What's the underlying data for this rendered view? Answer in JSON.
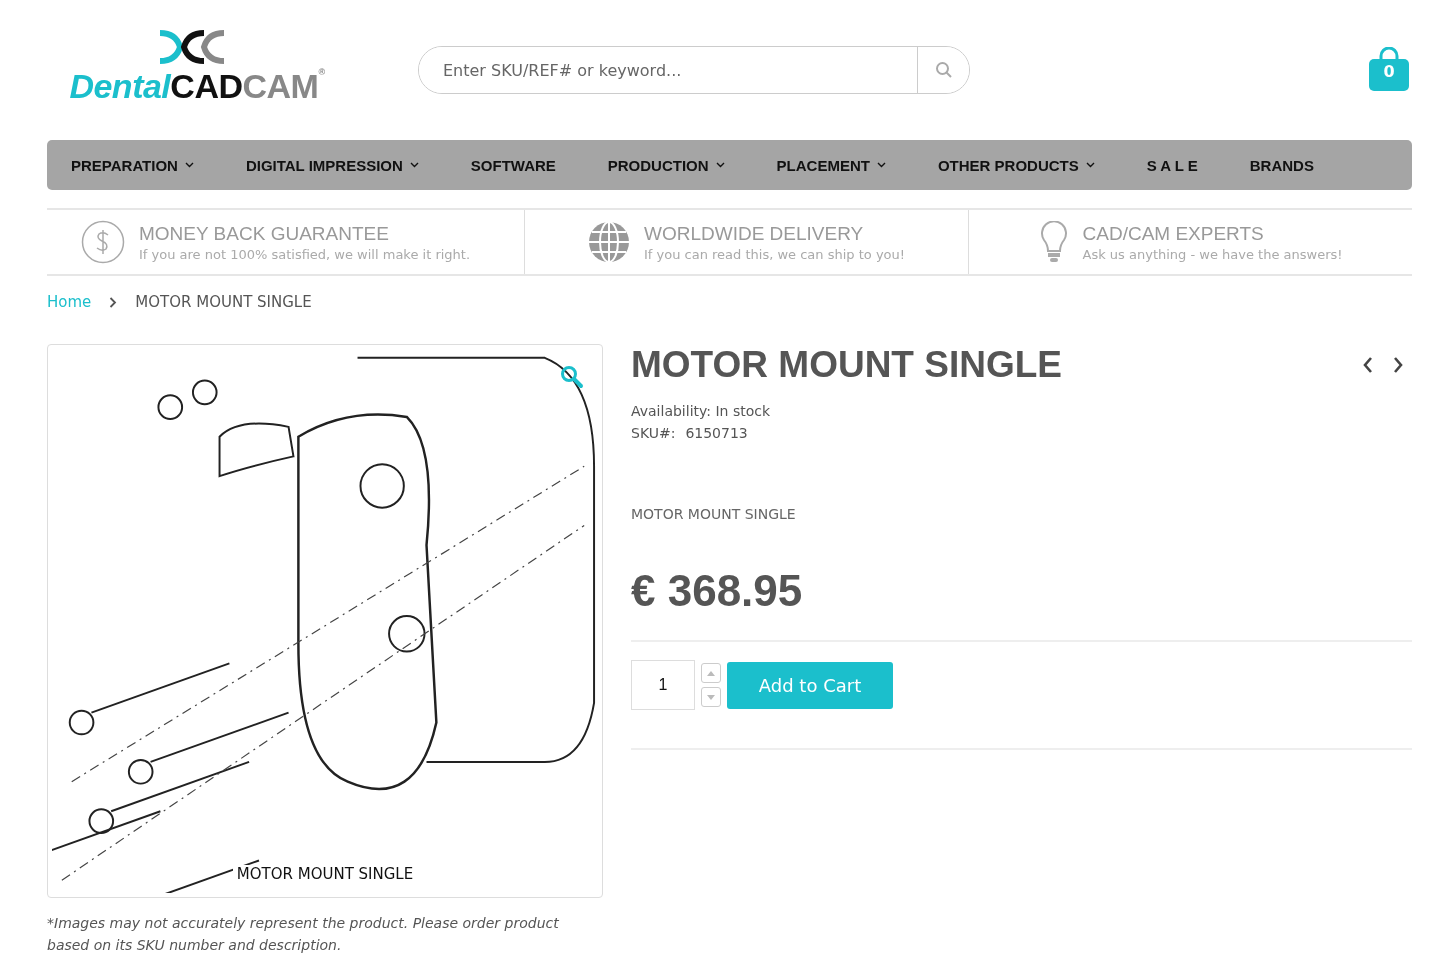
{
  "logo": {
    "parts": [
      "Dental",
      "CAD",
      "CAM"
    ],
    "mark": "®"
  },
  "search": {
    "placeholder": "Enter SKU/REF# or keyword..."
  },
  "cart": {
    "count": "0"
  },
  "nav": [
    {
      "label": "PREPARATION",
      "dropdown": true
    },
    {
      "label": "DIGITAL IMPRESSION",
      "dropdown": true
    },
    {
      "label": "SOFTWARE",
      "dropdown": false
    },
    {
      "label": "PRODUCTION",
      "dropdown": true
    },
    {
      "label": "PLACEMENT",
      "dropdown": true
    },
    {
      "label": "OTHER PRODUCTS",
      "dropdown": true
    },
    {
      "label": "S A L E",
      "dropdown": false
    },
    {
      "label": "BRANDS",
      "dropdown": false
    }
  ],
  "features": [
    {
      "kind": "dollar",
      "title": "MONEY BACK GUARANTEE",
      "text": "If you are not 100% satisfied, we will make it right."
    },
    {
      "kind": "globe",
      "title": "WORLDWIDE DELIVERY",
      "text": "If you can read this, we can ship to you!"
    },
    {
      "kind": "bulb",
      "title": "CAD/CAM EXPERTS",
      "text": "Ask us anything - we have the answers!"
    }
  ],
  "breadcrumb": [
    "Home",
    "MOTOR MOUNT SINGLE"
  ],
  "gallery": {
    "caption": "MOTOR MOUNT SINGLE",
    "disclaimer": "*Images may not accurately represent the product. Please order product based on its SKU number and description."
  },
  "product": {
    "title": "MOTOR MOUNT SINGLE",
    "availability": "Availability: In stock",
    "sku_label": "SKU#:",
    "sku": "6150713",
    "description": "MOTOR MOUNT SINGLE",
    "price": "€ 368.95",
    "quantity": "1",
    "add_button": "Add to Cart"
  }
}
